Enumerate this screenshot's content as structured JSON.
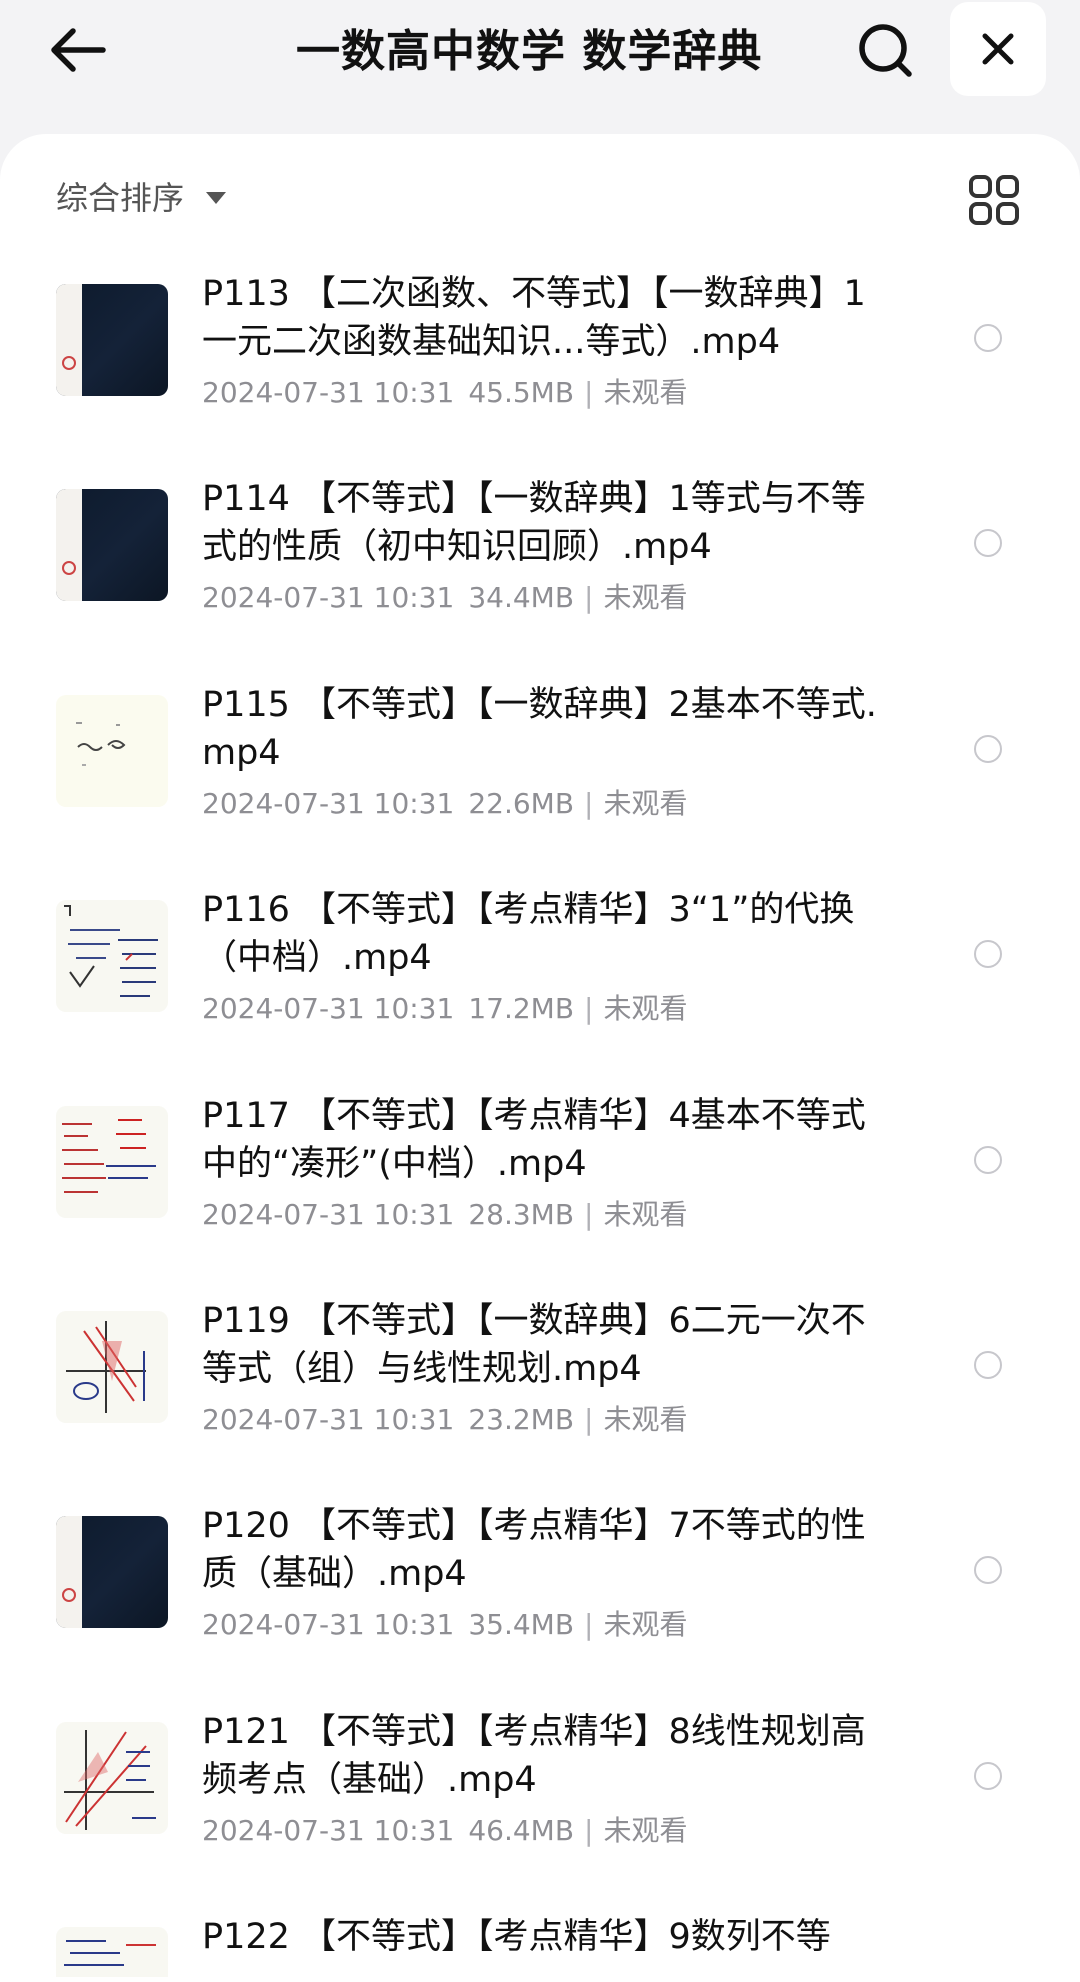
{
  "header": {
    "title": "一数高中数学 数学辞典",
    "icons": {
      "back": "arrow-left-icon",
      "search": "search-icon",
      "close": "close-icon"
    }
  },
  "toolbar": {
    "sort_label": "综合排序",
    "view_toggle_icon": "grid-view-icon"
  },
  "files": [
    {
      "title": "P113 【二次函数、不等式】【一数辞典】1一元二次函数基础知识...等式）.mp4",
      "date": "2024-07-31 10:31",
      "size": "45.5MB",
      "status": "未观看",
      "thumb": "dark"
    },
    {
      "title": "P114 【不等式】【一数辞典】1等式与不等式的性质（初中知识回顾）.mp4",
      "date": "2024-07-31 10:31",
      "size": "34.4MB",
      "status": "未观看",
      "thumb": "dark"
    },
    {
      "title": "P115 【不等式】【一数辞典】2基本不等式.mp4",
      "date": "2024-07-31 10:31",
      "size": "22.6MB",
      "status": "未观看",
      "thumb": "light"
    },
    {
      "title": "P116 【不等式】【考点精华】3“1”的代换（中档）.mp4",
      "date": "2024-07-31 10:31",
      "size": "17.2MB",
      "status": "未观看",
      "thumb": "paper"
    },
    {
      "title": "P117 【不等式】【考点精华】4基本不等式中的“凑形”(中档）.mp4",
      "date": "2024-07-31 10:31",
      "size": "28.3MB",
      "status": "未观看",
      "thumb": "paper"
    },
    {
      "title": "P119 【不等式】【一数辞典】6二元一次不等式（组）与线性规划.mp4",
      "date": "2024-07-31 10:31",
      "size": "23.2MB",
      "status": "未观看",
      "thumb": "paper"
    },
    {
      "title": "P120 【不等式】【考点精华】7不等式的性质（基础）.mp4",
      "date": "2024-07-31 10:31",
      "size": "35.4MB",
      "status": "未观看",
      "thumb": "dark"
    },
    {
      "title": "P121 【不等式】【考点精华】8线性规划高频考点（基础）.mp4",
      "date": "2024-07-31 10:31",
      "size": "46.4MB",
      "status": "未观看",
      "thumb": "paper"
    },
    {
      "title": "P122 【不等式】【考点精华】9数列不等",
      "date": "",
      "size": "",
      "status": "",
      "thumb": "paper"
    }
  ]
}
